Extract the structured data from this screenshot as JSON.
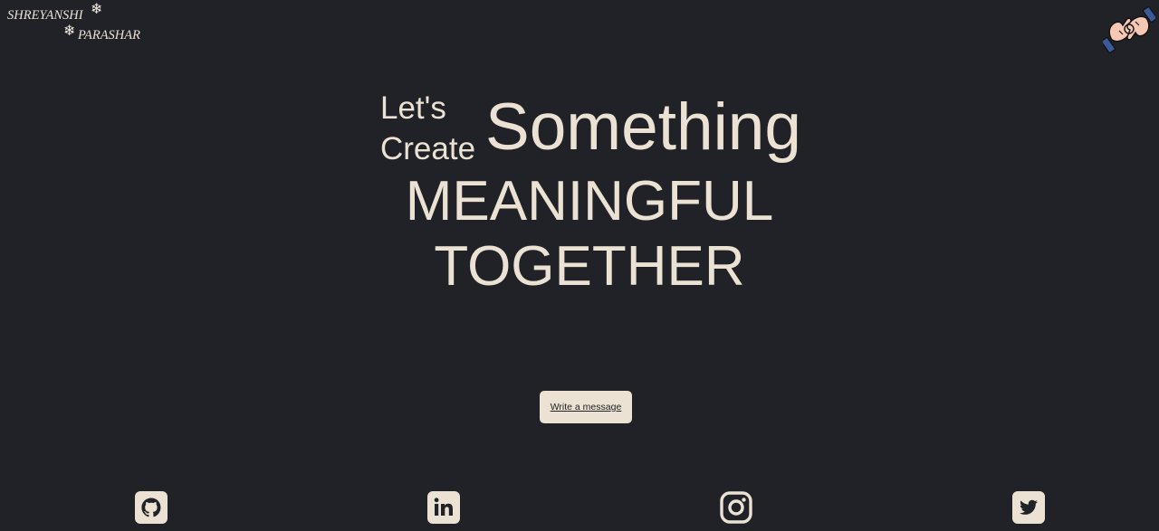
{
  "logo": {
    "first_name": "SHREYANSHI",
    "last_name": "PARASHAR",
    "flake": "❄"
  },
  "hero": {
    "lets": "Let's",
    "create": "Create",
    "something": "Something",
    "meaningful": "MEANINGFUL",
    "together": "TOGETHER"
  },
  "cta": {
    "label": "Write a message"
  },
  "social": {
    "icons": [
      "github-icon",
      "linkedin-icon",
      "instagram-icon",
      "twitter-icon"
    ]
  },
  "colors": {
    "background": "#202227",
    "accent": "#ebe2d3"
  }
}
